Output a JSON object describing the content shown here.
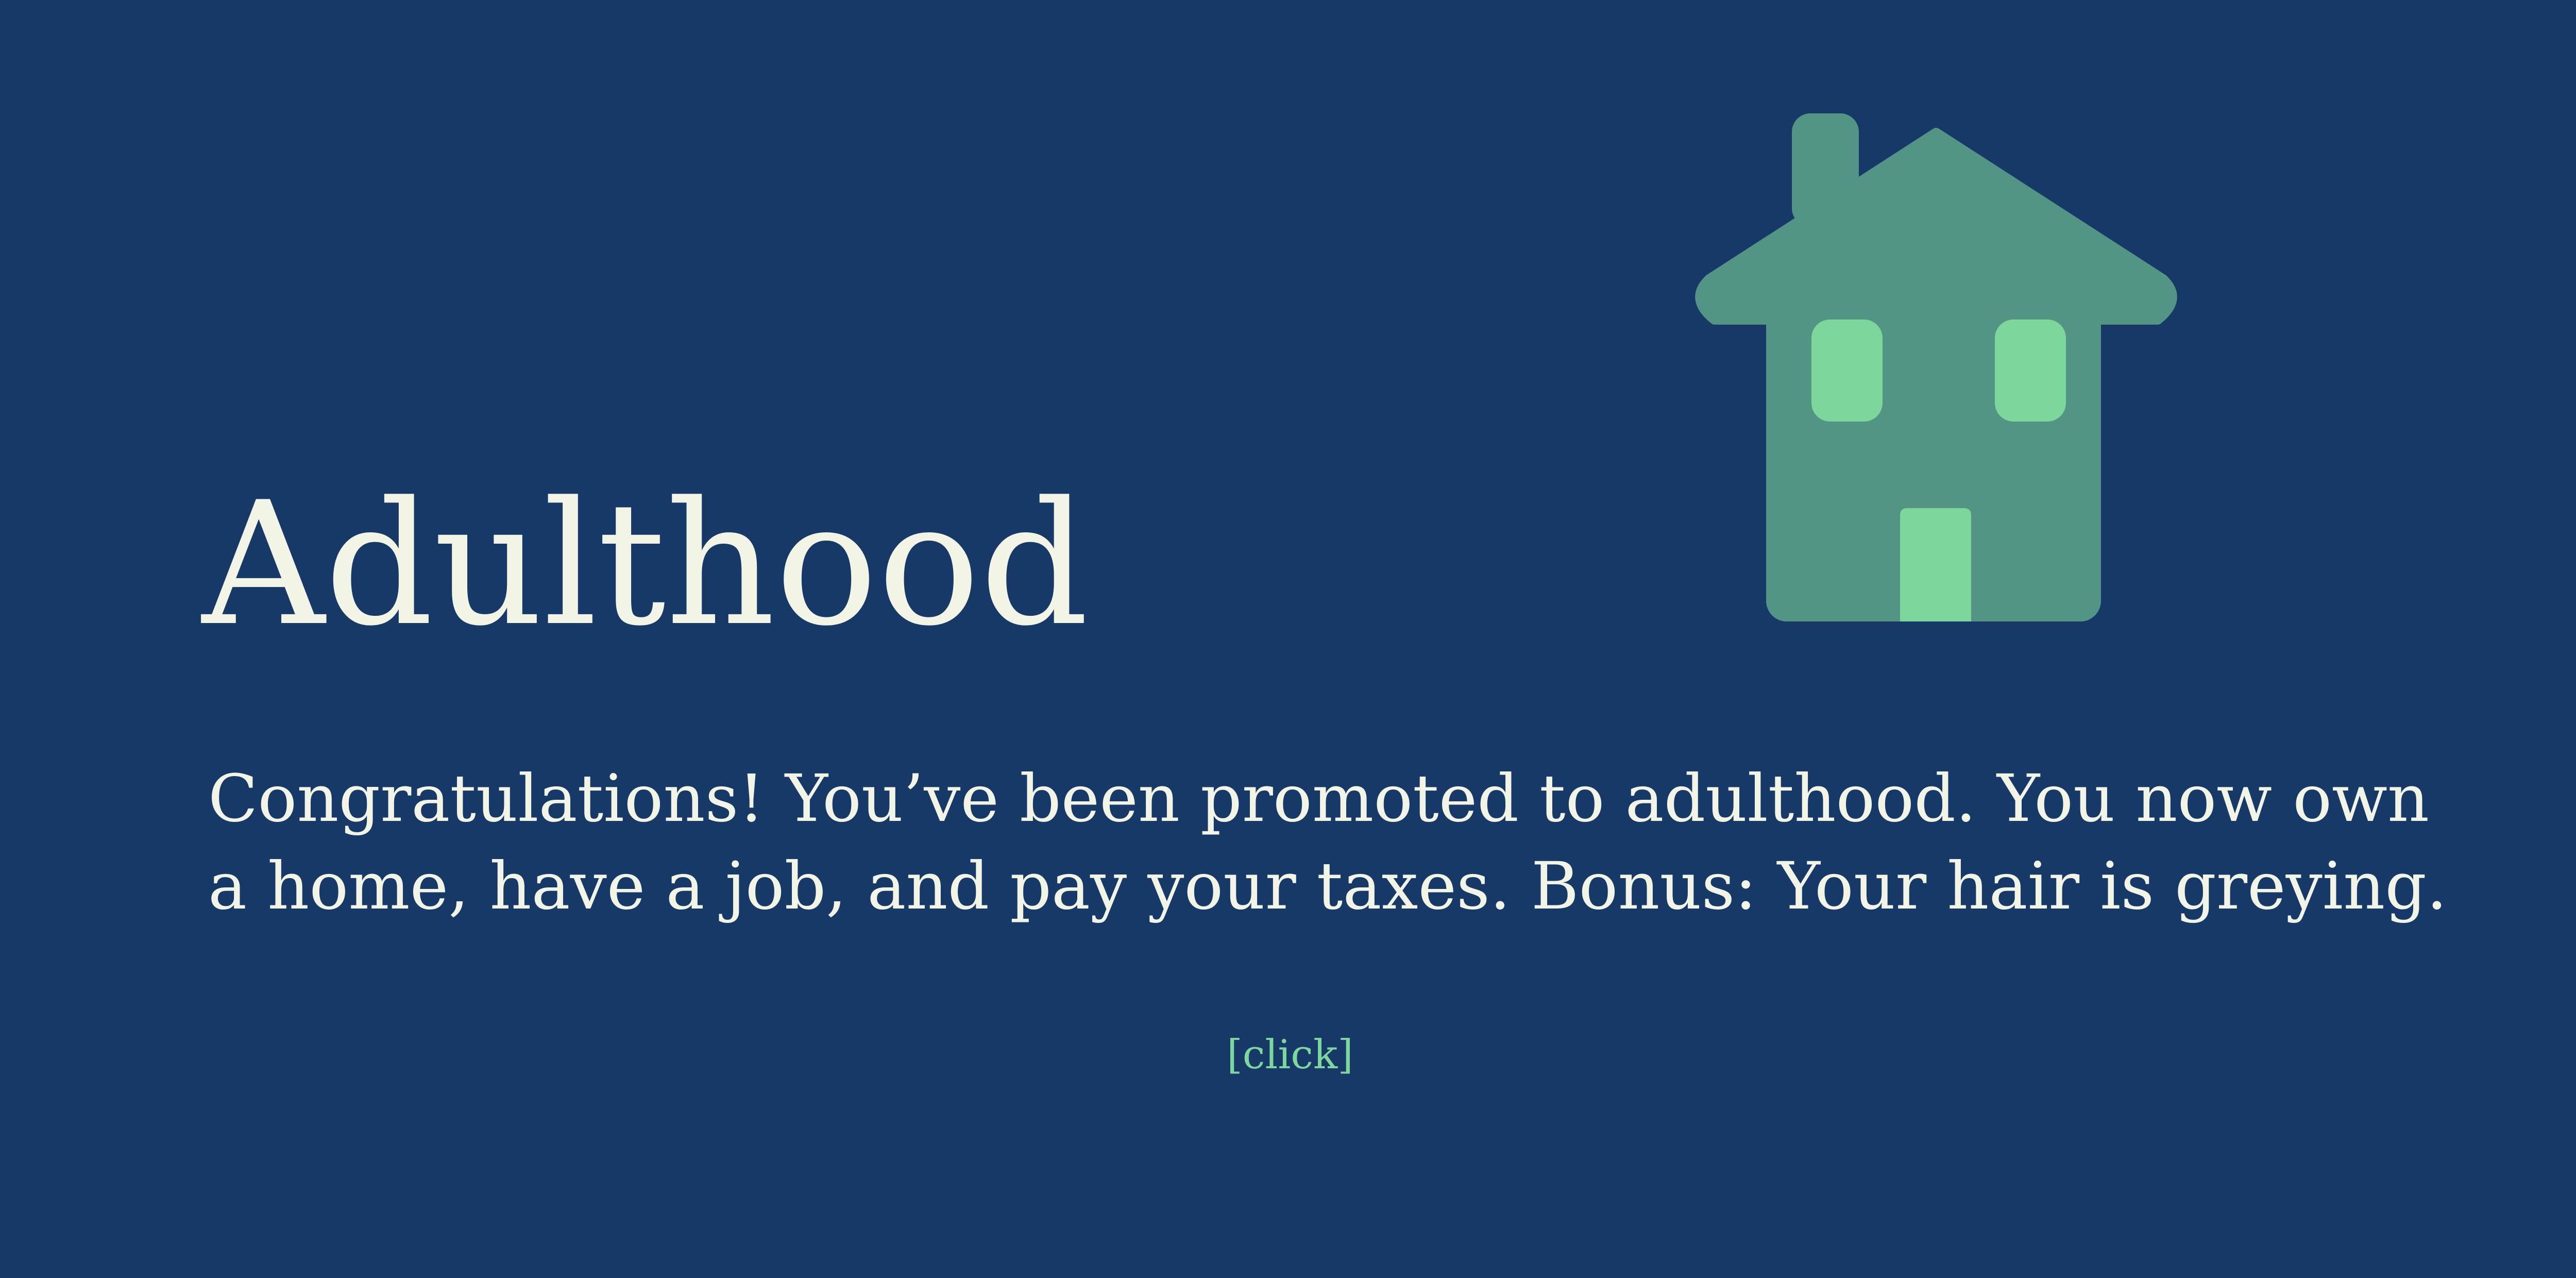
{
  "slide": {
    "title": "Adulthood",
    "body_lines": [
      "Congratulations! You’ve been promoted to adulthood. You now own",
      "a home, have a job, and pay your taxes. Bonus: Your hair is greying."
    ],
    "click_label": "[click]"
  },
  "icon": {
    "name": "house-icon"
  },
  "colors": {
    "background": "#163968",
    "text": "#f2f5e6",
    "house": "#539585",
    "house_accent": "#7dd69c",
    "link": "#7dd69c"
  }
}
